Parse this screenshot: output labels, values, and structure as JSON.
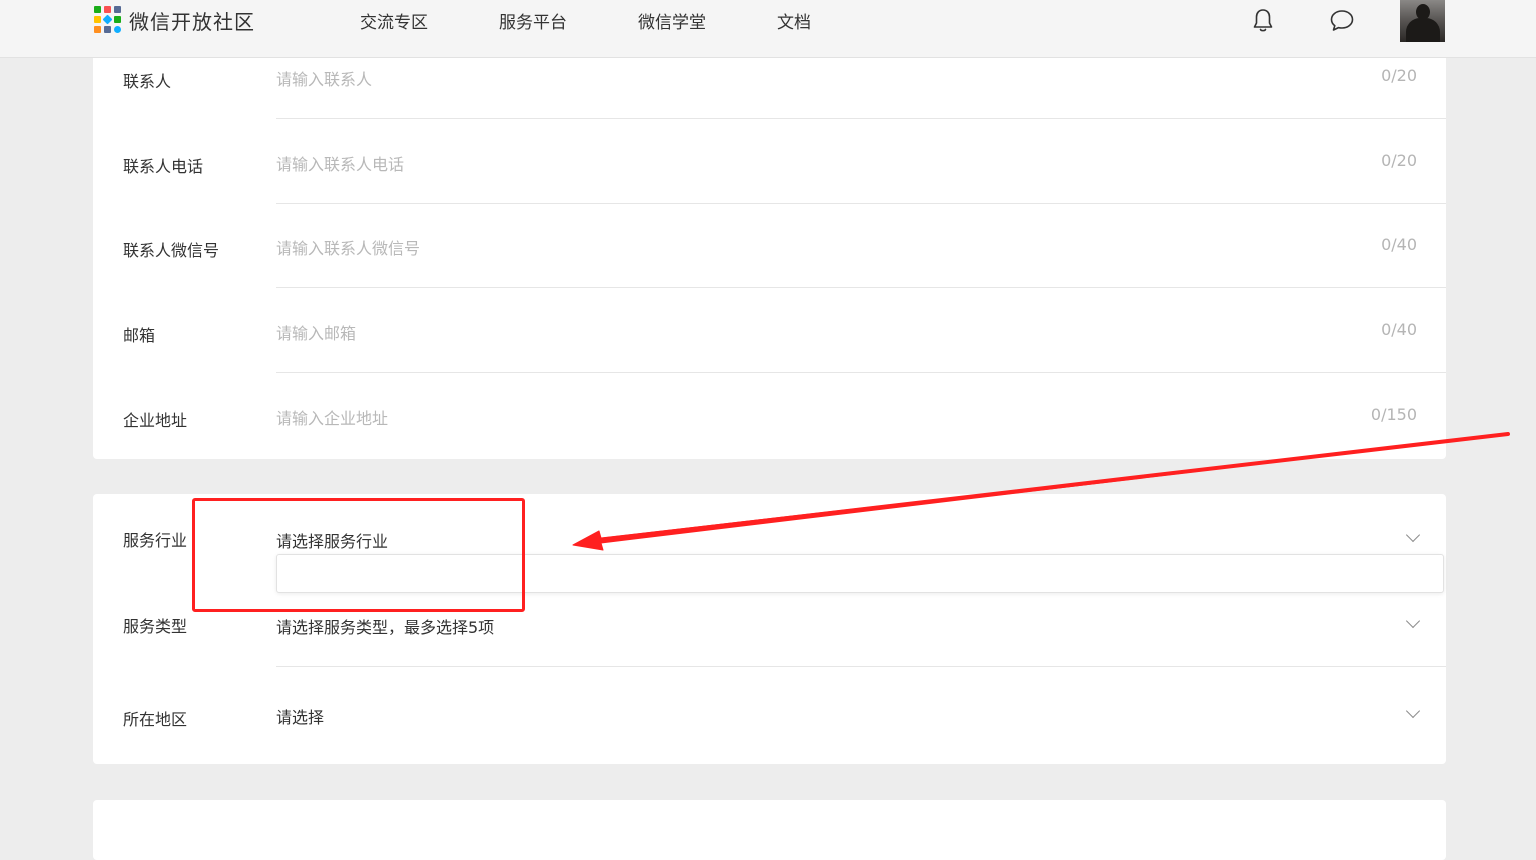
{
  "header": {
    "brand": "微信开放社区",
    "nav": [
      "交流专区",
      "服务平台",
      "微信学堂",
      "文档"
    ],
    "icons": [
      "bell-icon",
      "chat-bubble-icon"
    ],
    "logo_colors": [
      "#1aad19",
      "#fa5151",
      "#576b95",
      "#ffc300",
      "#10aeff",
      "#ff8f1f"
    ]
  },
  "contact_form": {
    "rows": [
      {
        "label": "联系人",
        "placeholder": "请输入联系人",
        "count": "0/20"
      },
      {
        "label": "联系人电话",
        "placeholder": "请输入联系人电话",
        "count": "0/20"
      },
      {
        "label": "联系人微信号",
        "placeholder": "请输入联系人微信号",
        "count": "0/40"
      },
      {
        "label": "邮箱",
        "placeholder": "请输入邮箱",
        "count": "0/40"
      },
      {
        "label": "企业地址",
        "placeholder": "请输入企业地址",
        "count": "0/150"
      }
    ]
  },
  "service_form": {
    "rows": [
      {
        "label": "服务行业",
        "value": "请选择服务行业"
      },
      {
        "label": "服务类型",
        "value": "请选择服务类型，最多选择5项"
      },
      {
        "label": "所在地区",
        "value": "请选择"
      }
    ]
  },
  "annotation": {
    "color": "#ff2020",
    "note": "highlighted empty dropdown under 服务行业"
  }
}
